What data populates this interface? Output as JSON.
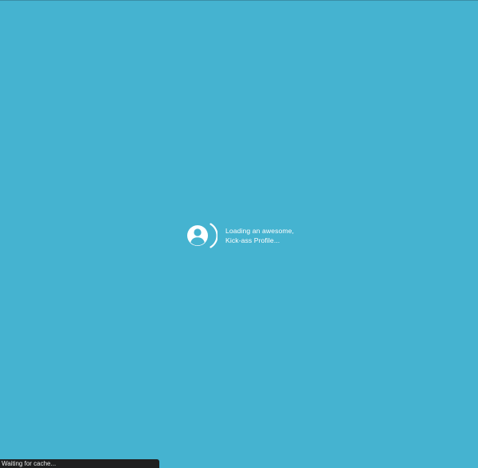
{
  "colors": {
    "background": "#45b3d0",
    "foreground": "#ffffff",
    "status_bar_bg": "#1f1f1f"
  },
  "loader": {
    "icon": "profile-spinner-icon",
    "line1": "Loading an awesome,",
    "line2": "Kick-ass Profile..."
  },
  "status_bar": {
    "text": "Waiting for cache..."
  }
}
